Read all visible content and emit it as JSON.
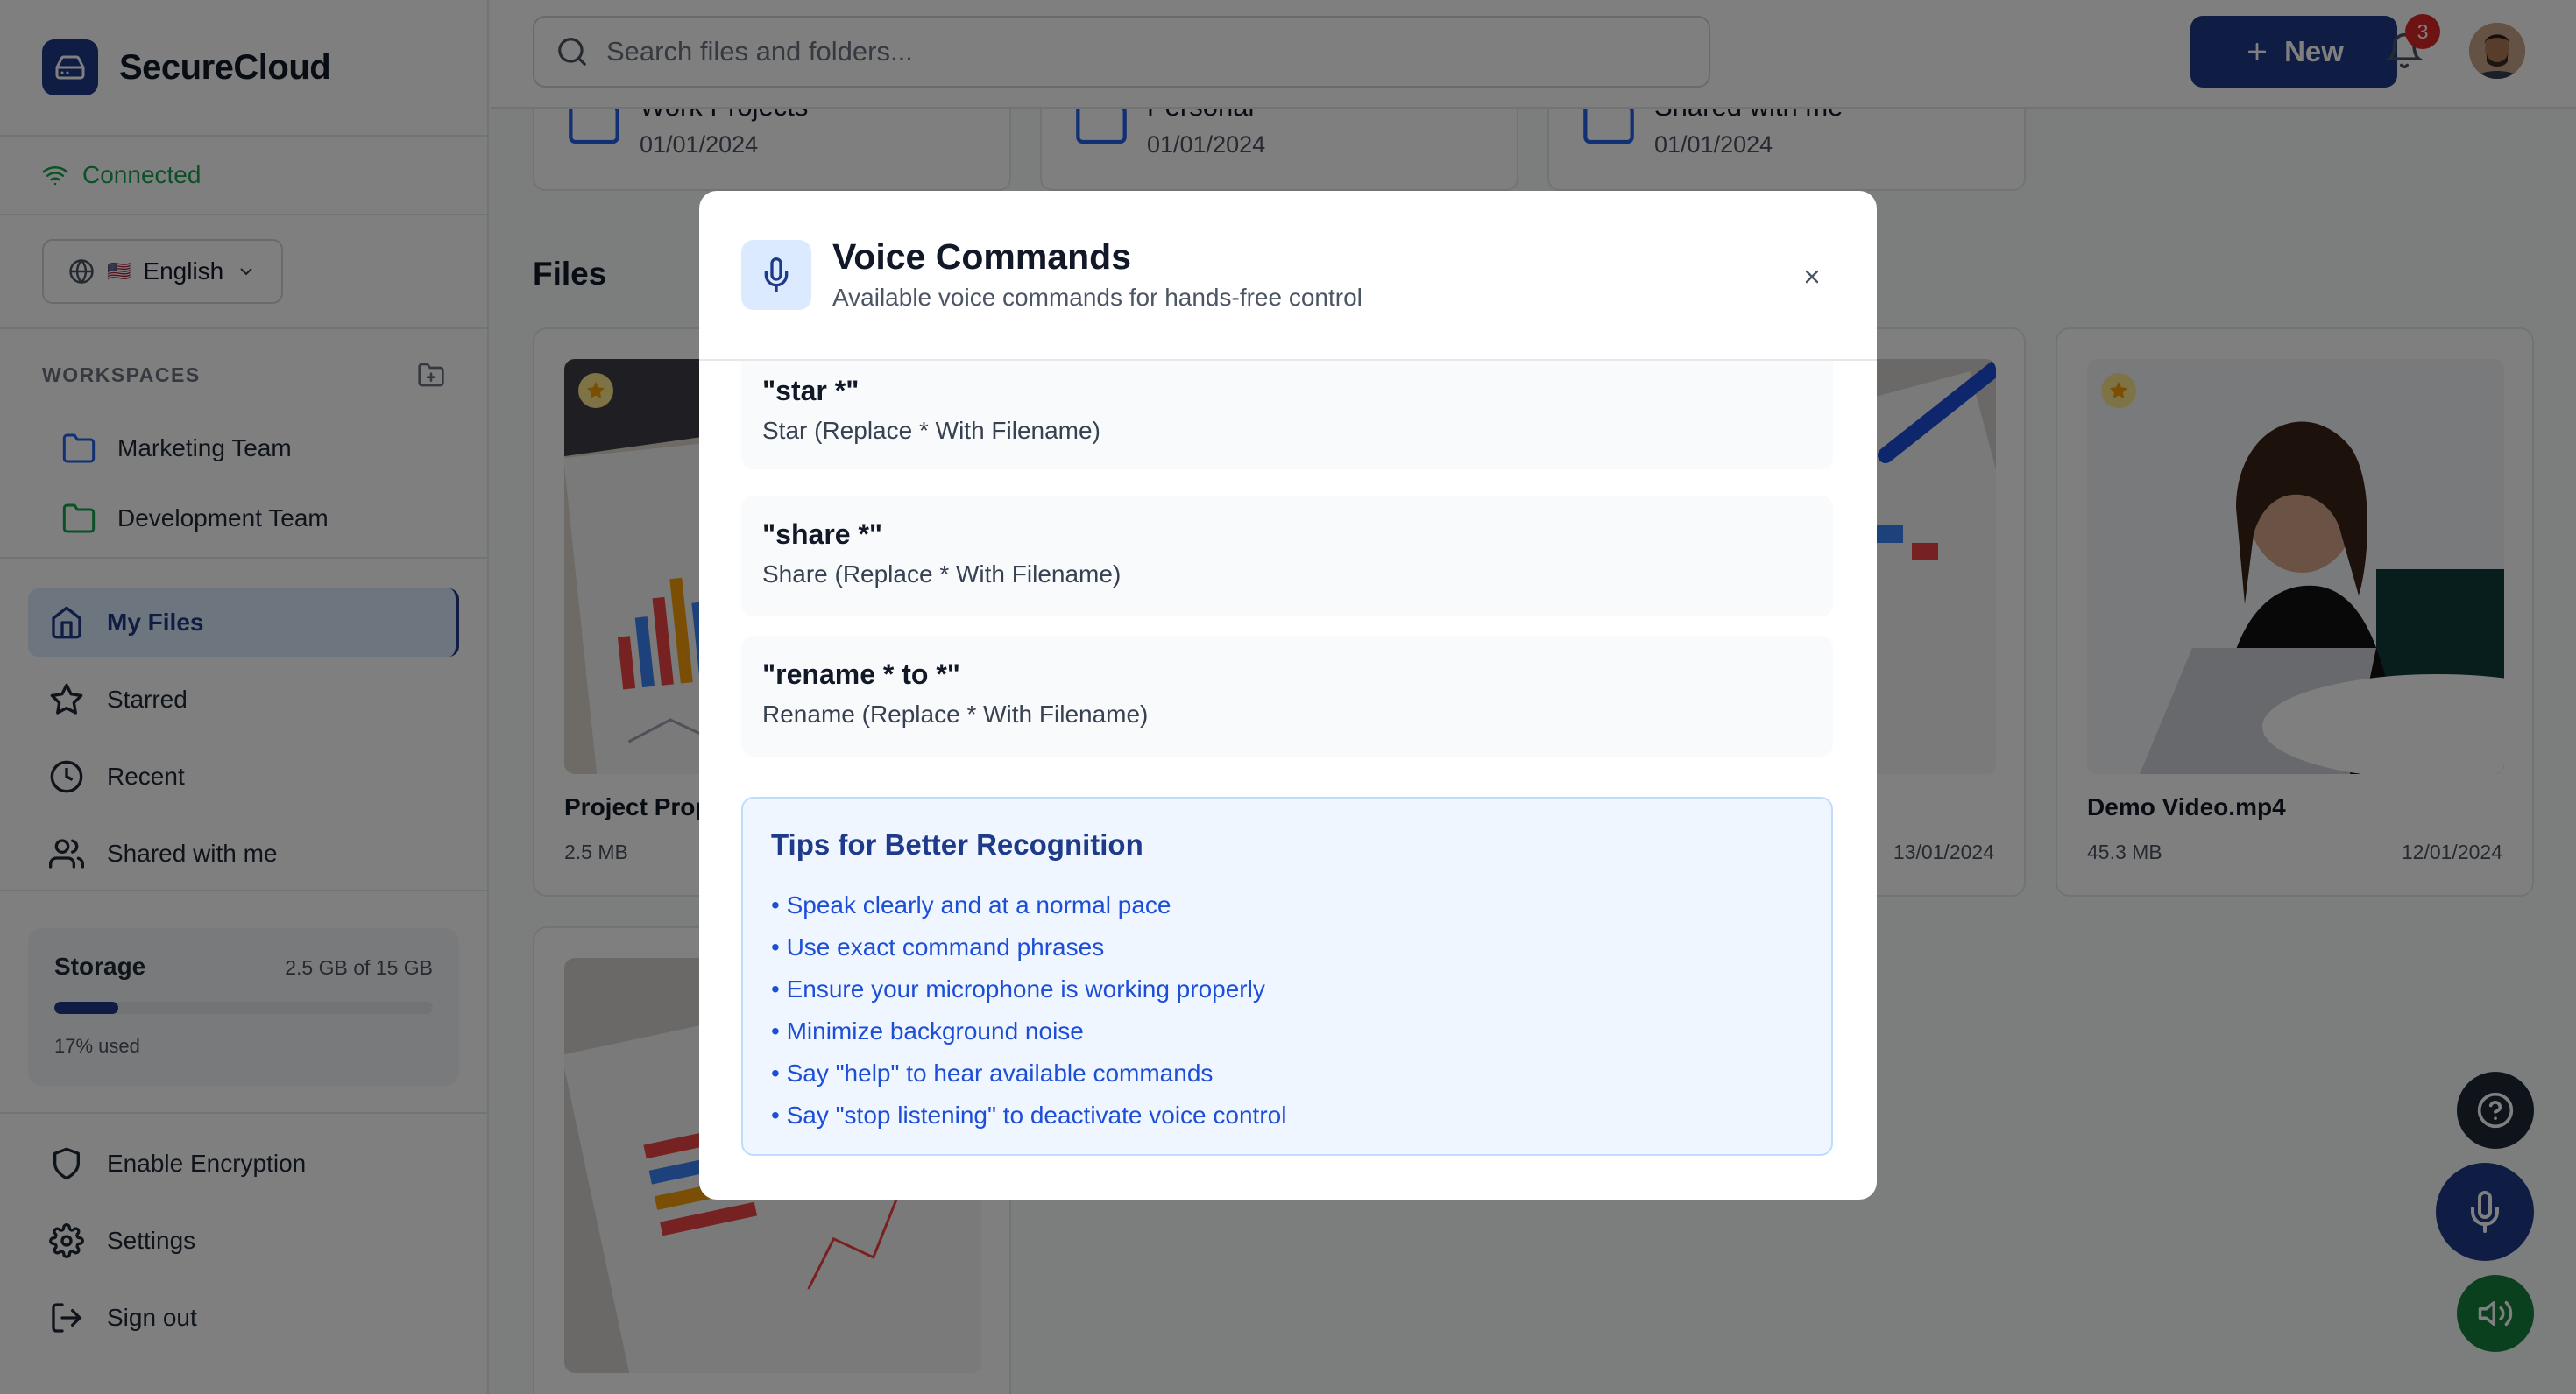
{
  "brand": {
    "name": "SecureCloud"
  },
  "connection": {
    "status": "Connected"
  },
  "language": {
    "selected": "English",
    "flag": "🇺🇸"
  },
  "workspaces": {
    "heading": "WORKSPACES",
    "items": [
      {
        "label": "Marketing Team",
        "color": "#2563eb"
      },
      {
        "label": "Development Team",
        "color": "#16a34a"
      }
    ]
  },
  "nav": {
    "items": [
      {
        "label": "My Files"
      },
      {
        "label": "Starred"
      },
      {
        "label": "Recent"
      },
      {
        "label": "Shared with me"
      }
    ]
  },
  "storage": {
    "title": "Storage",
    "amount": "2.5 GB of 15 GB",
    "used_label": "17% used",
    "used_fraction": 0.17
  },
  "bottom_nav": {
    "items": [
      {
        "label": "Enable Encryption"
      },
      {
        "label": "Settings"
      },
      {
        "label": "Sign out"
      }
    ]
  },
  "header": {
    "search_placeholder": "Search files and folders...",
    "new_label": "New",
    "notification_count": "3"
  },
  "folders": [
    {
      "name": "Work Projects",
      "date": "01/01/2024"
    },
    {
      "name": "Personal",
      "date": "01/01/2024"
    },
    {
      "name": "Shared with me",
      "date": "01/01/2024"
    }
  ],
  "files": {
    "title": "Files",
    "items": [
      {
        "name": "Project Prop",
        "size": "2.5 MB",
        "date": ""
      },
      {
        "name": "",
        "size": "",
        "date": "13/01/2024"
      },
      {
        "name": "Demo Video.mp4",
        "size": "45.3 MB",
        "date": "12/01/2024"
      }
    ]
  },
  "modal": {
    "title": "Voice Commands",
    "subtitle": "Available voice commands for hands-free control",
    "commands": [
      {
        "phrase": "\"star *\"",
        "description": "Star (Replace * With Filename)"
      },
      {
        "phrase": "\"share *\"",
        "description": "Share (Replace * With Filename)"
      },
      {
        "phrase": "\"rename * to *\"",
        "description": "Rename (Replace * With Filename)"
      }
    ],
    "tips_title": "Tips for Better Recognition",
    "tips": [
      "• Speak clearly and at a normal pace",
      "• Use exact command phrases",
      "• Ensure your microphone is working properly",
      "• Minimize background noise",
      "• Say \"help\" to hear available commands",
      "• Say \"stop listening\" to deactivate voice control"
    ]
  },
  "colors": {
    "primary": "#1e3a8a",
    "success": "#16a34a",
    "danger": "#dc2626",
    "tip_text": "#1d4ed8"
  }
}
